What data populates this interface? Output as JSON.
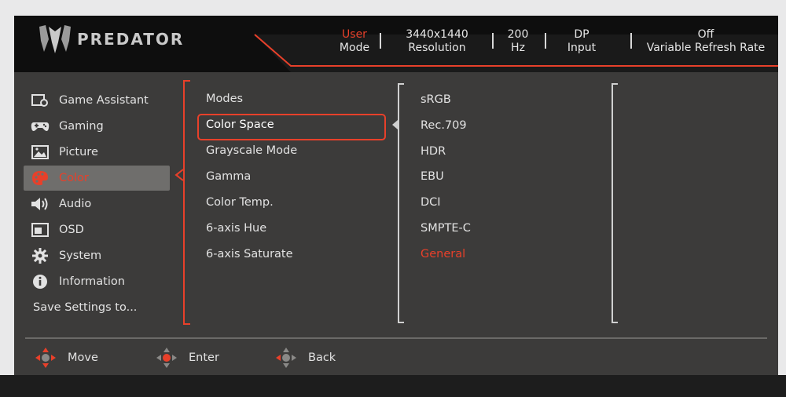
{
  "header": {
    "brand": "PREDATOR",
    "status": [
      {
        "line1": "User",
        "line2": "Mode",
        "highlight_line1": true
      },
      {
        "line1": "3440x1440",
        "line2": "Resolution"
      },
      {
        "line1": "200",
        "line2": "Hz"
      },
      {
        "line1": "DP",
        "line2": "Input"
      },
      {
        "line1": "Off",
        "line2": "Variable Refresh Rate"
      }
    ]
  },
  "sidebar": {
    "items": [
      {
        "label": "Game Assistant",
        "icon": "game-assistant-icon"
      },
      {
        "label": "Gaming",
        "icon": "gamepad-icon"
      },
      {
        "label": "Picture",
        "icon": "picture-icon"
      },
      {
        "label": "Color",
        "icon": "palette-icon",
        "active": true
      },
      {
        "label": "Audio",
        "icon": "speaker-icon"
      },
      {
        "label": "OSD",
        "icon": "osd-icon"
      },
      {
        "label": "System",
        "icon": "gear-icon"
      },
      {
        "label": "Information",
        "icon": "info-icon"
      },
      {
        "label": "Save Settings to...",
        "icon": ""
      }
    ]
  },
  "color_menu": {
    "items": [
      "Modes",
      "Color Space",
      "Grayscale Mode",
      "Gamma",
      "Color Temp.",
      "6-axis Hue",
      "6-axis Saturate"
    ],
    "selected": "Color Space"
  },
  "color_space_options": {
    "items": [
      "sRGB",
      "Rec.709",
      "HDR",
      "EBU",
      "DCI",
      "SMPTE-C",
      "General"
    ],
    "current": "General"
  },
  "footer": {
    "move": "Move",
    "enter": "Enter",
    "back": "Back"
  },
  "colors": {
    "accent": "#e8402a",
    "panel": "#3c3b3a",
    "header": "#0e0e0e",
    "active_bg": "#6f6e6c"
  }
}
